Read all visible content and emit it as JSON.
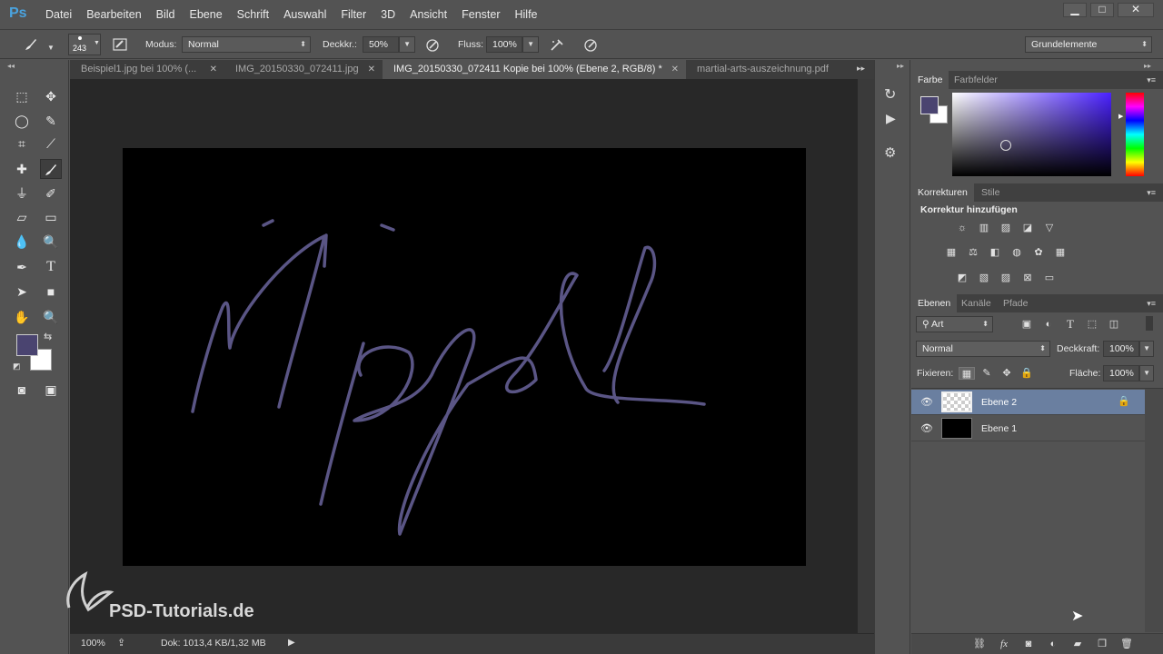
{
  "app": {
    "logo": "Ps"
  },
  "menu": [
    "Datei",
    "Bearbeiten",
    "Bild",
    "Ebene",
    "Schrift",
    "Auswahl",
    "Filter",
    "3D",
    "Ansicht",
    "Fenster",
    "Hilfe"
  ],
  "window_buttons": {
    "minimize": "▁",
    "maximize": "□",
    "close": "✕"
  },
  "options": {
    "brush_size": "243",
    "mode_label": "Modus:",
    "mode_value": "Normal",
    "opacity_label": "Deckkr.:",
    "opacity_value": "50%",
    "flow_label": "Fluss:",
    "flow_value": "100%",
    "workspace": "Grundelemente"
  },
  "tabs": [
    {
      "label": "Beispiel1.jpg bei 100% (..."
    },
    {
      "label": "IMG_20150330_072411.jpg"
    },
    {
      "label": "IMG_20150330_072411 Kopie bei 100% (Ebene 2, RGB/8) *"
    },
    {
      "label": "martial-arts-auszeichnung.pdf"
    }
  ],
  "colors": {
    "foreground": "#4a4470",
    "background": "#ffffff",
    "stroke": "#5a5585"
  },
  "watermark": {
    "text": "PSD-Tutorials.de"
  },
  "status": {
    "zoom": "100%",
    "doc": "Dok: 1013,4 KB/1,32 MB"
  },
  "panels": {
    "color": {
      "tabs": [
        "Farbe",
        "Farbfelder"
      ]
    },
    "adjustments": {
      "tabs": [
        "Korrekturen",
        "Stile"
      ],
      "title": "Korrektur hinzufügen"
    },
    "layers": {
      "tabs": [
        "Ebenen",
        "Kanäle",
        "Pfade"
      ],
      "filter_value": "Art",
      "blend_mode": "Normal",
      "opacity_label": "Deckkraft:",
      "opacity_value": "100%",
      "lock_label": "Fixieren:",
      "fill_label": "Fläche:",
      "fill_value": "100%",
      "items": [
        {
          "name": "Ebene 2",
          "selected": true
        },
        {
          "name": "Ebene 1",
          "selected": false
        }
      ]
    }
  }
}
